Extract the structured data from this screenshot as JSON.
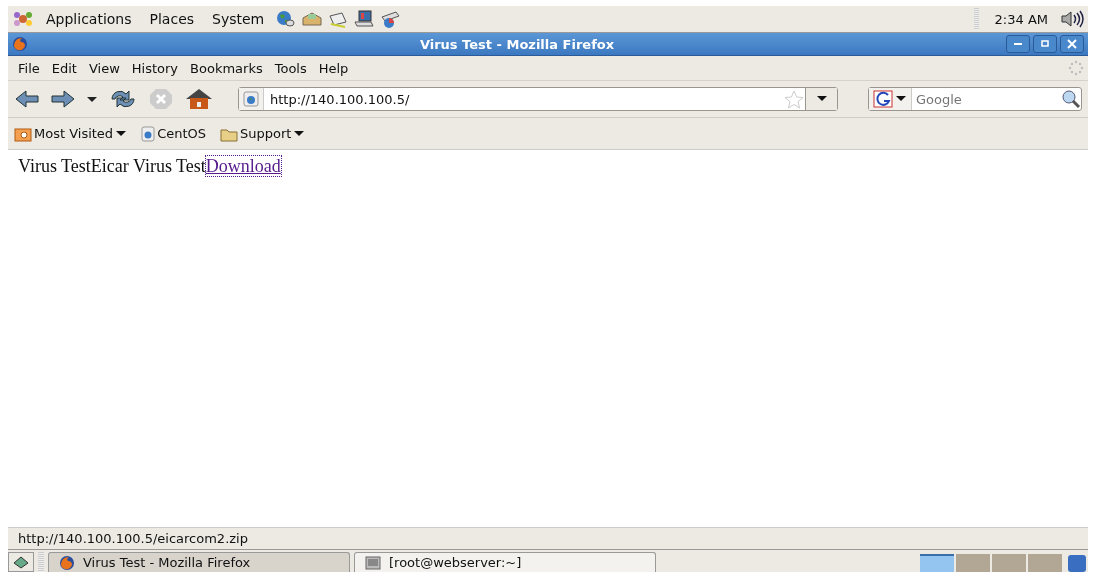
{
  "top_panel": {
    "menus": [
      "Applications",
      "Places",
      "System"
    ],
    "clock": "2:34 AM"
  },
  "window": {
    "title": "Virus Test - Mozilla Firefox"
  },
  "menu_bar": [
    "File",
    "Edit",
    "View",
    "History",
    "Bookmarks",
    "Tools",
    "Help"
  ],
  "nav_bar": {
    "url": "http://140.100.100.5/",
    "search_placeholder": "Google"
  },
  "bookmarks": [
    {
      "label": "Most Visited",
      "kind": "menu"
    },
    {
      "label": "CentOS",
      "kind": "page"
    },
    {
      "label": "Support",
      "kind": "folder"
    }
  ],
  "content": {
    "text": "Virus TestEicar Virus Test",
    "link": "Download"
  },
  "status_bar": "http://140.100.100.5/eicarcom2.zip",
  "taskbar": {
    "windows": [
      {
        "label": "Virus Test - Mozilla Firefox",
        "kind": "browser",
        "selected": true
      },
      {
        "label": "[root@webserver:~]",
        "kind": "terminal",
        "selected": false
      }
    ],
    "workspaces": [
      {
        "selected": true
      },
      {
        "selected": false
      },
      {
        "selected": false
      },
      {
        "selected": false
      }
    ]
  }
}
